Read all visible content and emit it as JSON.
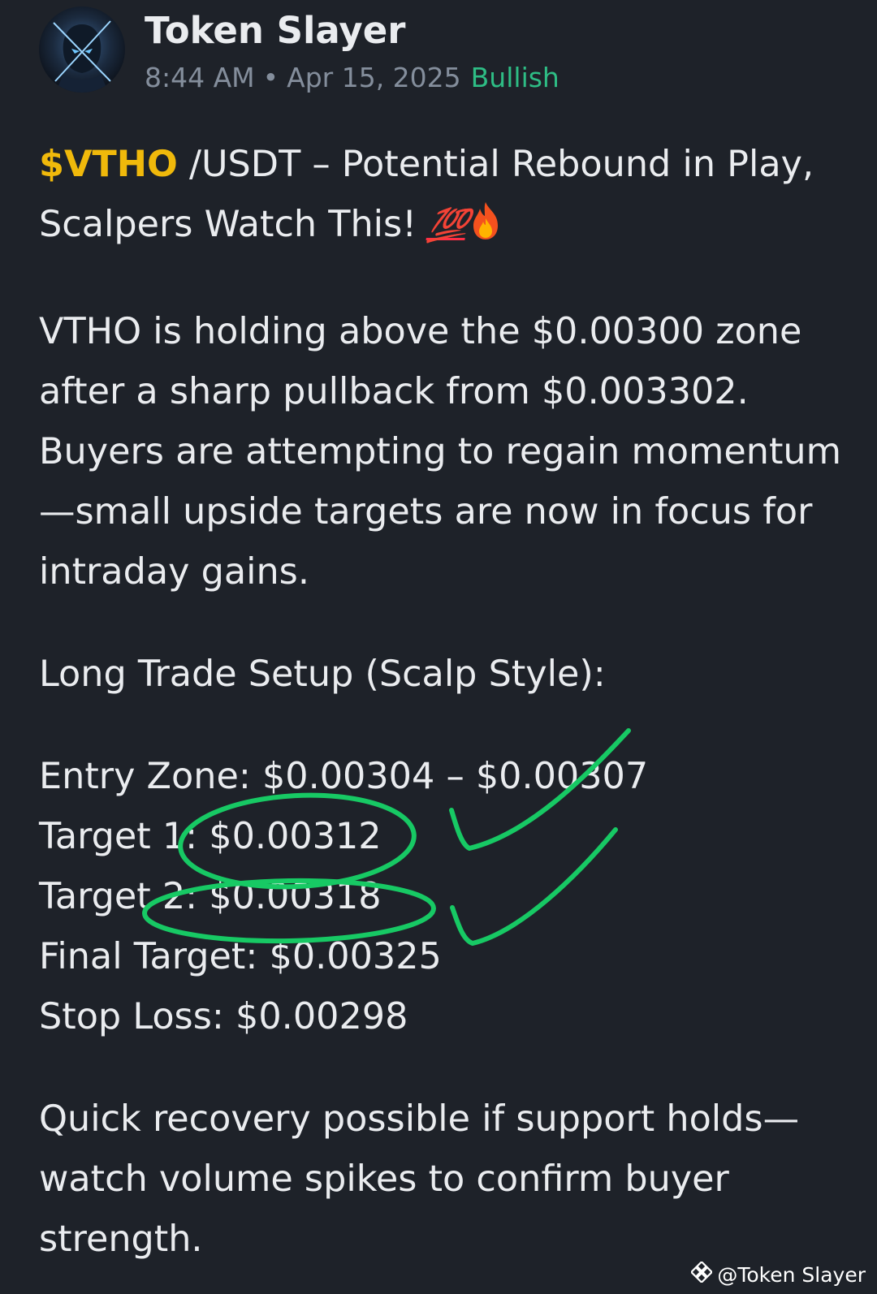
{
  "post": {
    "author": "Token Slayer",
    "time": "8:44 AM",
    "separator": "•",
    "date": "Apr 15, 2025",
    "sentiment": "Bullish"
  },
  "content": {
    "ticker": "$VTHO",
    "title_rest": " /USDT – Potential Rebound in Play, Scalpers Watch This! ",
    "emoji_100": "💯",
    "emoji_fire": "🔥",
    "paragraph_1": "VTHO is holding above the $0.00300 zone after a sharp pullback from $0.003302. Buyers are attempting to regain momentum—small upside targets are now in focus for intraday gains.",
    "setup_heading": "Long Trade Setup (Scalp Style):",
    "entry_zone": "Entry Zone: $0.00304 – $0.00307",
    "target_1": "Target 1: $0.00312",
    "target_2": "Target 2: $0.00318",
    "final_target": "Final Target: $0.00325",
    "stop_loss": "Stop Loss: $0.00298",
    "closing": "Quick recovery possible if support holds—watch volume spikes to confirm buyer strength."
  },
  "colors": {
    "background": "#1e2229",
    "ticker": "#f0b90b",
    "bullish": "#2ebd85",
    "annotation_ink": "#17c964"
  },
  "watermark": {
    "text": "@Token Slayer",
    "icon": "binance-logo-icon"
  },
  "avatar": {
    "icon": "hooded-warrior-avatar"
  }
}
